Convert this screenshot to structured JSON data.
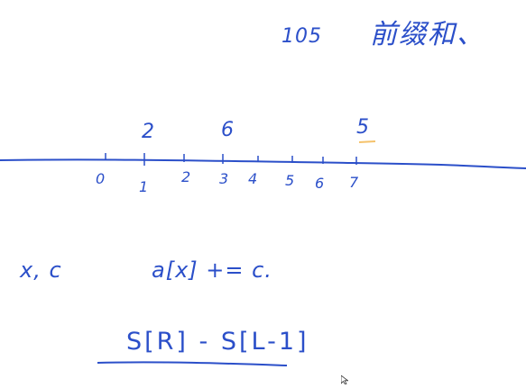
{
  "header": {
    "number": "105",
    "title": "前缀和、"
  },
  "number_line": {
    "tick_labels": [
      "0",
      "1",
      "2",
      "3",
      "4",
      "5",
      "6",
      "7"
    ],
    "values": [
      {
        "at": "1",
        "text": "2"
      },
      {
        "at": "3",
        "text": "6"
      },
      {
        "at": "7",
        "text": "5"
      }
    ]
  },
  "notes": {
    "left": "x, c",
    "assign": "a[x] += c."
  },
  "formula": {
    "text": "S[R] - S[L-1]"
  },
  "colors": {
    "ink": "#2b4fc9",
    "highlight": "#f5c26b",
    "background": "#ffffff"
  },
  "icons": {
    "cursor": "mouse-pointer-icon"
  }
}
